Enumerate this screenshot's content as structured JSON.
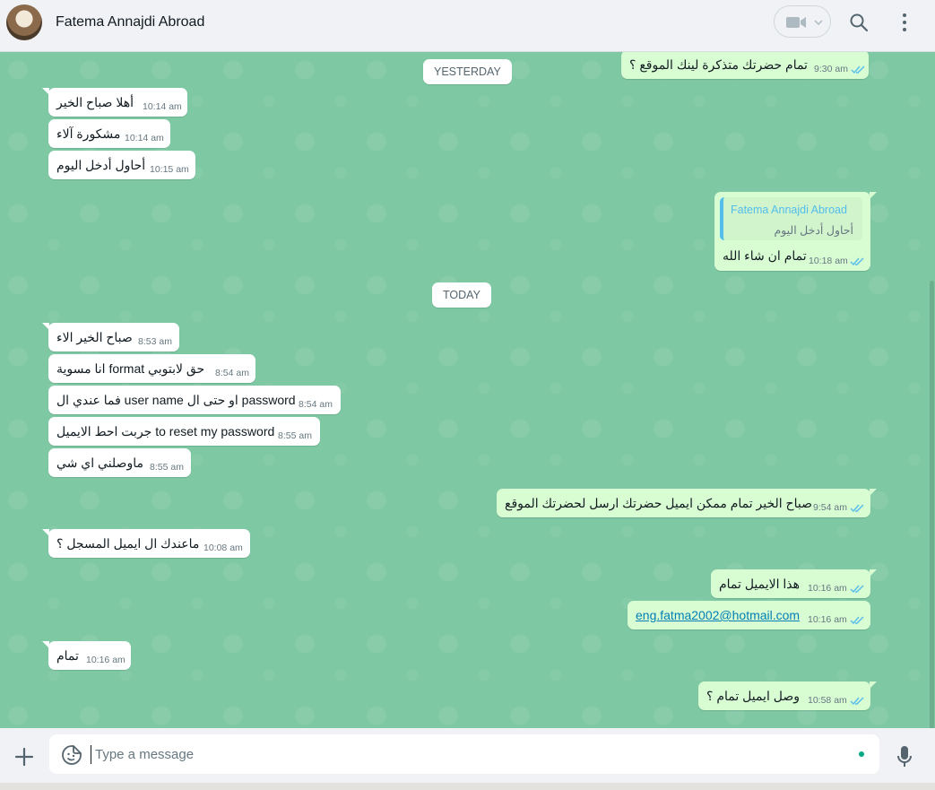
{
  "header": {
    "contact_name": "Fatema Annajdi Abroad",
    "icons": [
      "avatar",
      "video-call-icon",
      "chevron-down-icon",
      "search-icon",
      "menu-icon"
    ]
  },
  "days": {
    "yesterday": "YESTERDAY",
    "today": "TODAY"
  },
  "messages": [
    {
      "dir": "out",
      "text": "تمام حضرتك متذكرة لينك الموقع ؟",
      "time": "9:30 am"
    },
    {
      "dir": "in",
      "text": "أهلا صباح الخير",
      "time": "10:14 am"
    },
    {
      "dir": "in",
      "text": "مشكورة آلاء",
      "time": "10:14 am"
    },
    {
      "dir": "in",
      "text": "أحاول أدخل اليوم",
      "time": "10:15 am"
    },
    {
      "dir": "out",
      "quote_name": "Fatema Annajdi Abroad",
      "quote_text": "أحاول أدخل اليوم",
      "text": "تمام ان شاء الله",
      "time": "10:18 am"
    },
    {
      "dir": "in",
      "text": "صباح الخير الاء",
      "time": "8:53 am"
    },
    {
      "dir": "in",
      "text": "انا مسوية format حق لابتوبي",
      "time": "8:54 am"
    },
    {
      "dir": "in",
      "text": "فما عندي ال user name او حتى ال password",
      "time": "8:54 am"
    },
    {
      "dir": "in",
      "text": "جربت احط الايميل to reset my password",
      "time": "8:55 am"
    },
    {
      "dir": "in",
      "text": "ماوصلني اي شي",
      "time": "8:55 am"
    },
    {
      "dir": "out",
      "text": "صباح الخير تمام ممكن ايميل حضرتك ارسل لحضرتك الموقع",
      "time": "9:54 am"
    },
    {
      "dir": "in",
      "text": "ماعندك ال ايميل المسجل ؟",
      "time": "10:08 am"
    },
    {
      "dir": "out",
      "text": "هذا الايميل تمام",
      "time": "10:16 am"
    },
    {
      "dir": "out",
      "text": "eng.fatma2002@hotmail.com",
      "time": "10:16 am"
    },
    {
      "dir": "in",
      "text": "تمام",
      "time": "10:16 am"
    },
    {
      "dir": "out",
      "text": "وصل ايميل تمام ؟",
      "time": "10:58 am"
    }
  ],
  "composer": {
    "placeholder": "Type a message",
    "icons": [
      "plus-icon",
      "sticker-icon",
      "mic-icon"
    ]
  },
  "colors": {
    "chat_bg": "#7ec8a3",
    "incoming": "#ffffff",
    "outgoing": "#d9fdd3",
    "read_ticks": "#53bdeb",
    "accent": "#00a884"
  }
}
